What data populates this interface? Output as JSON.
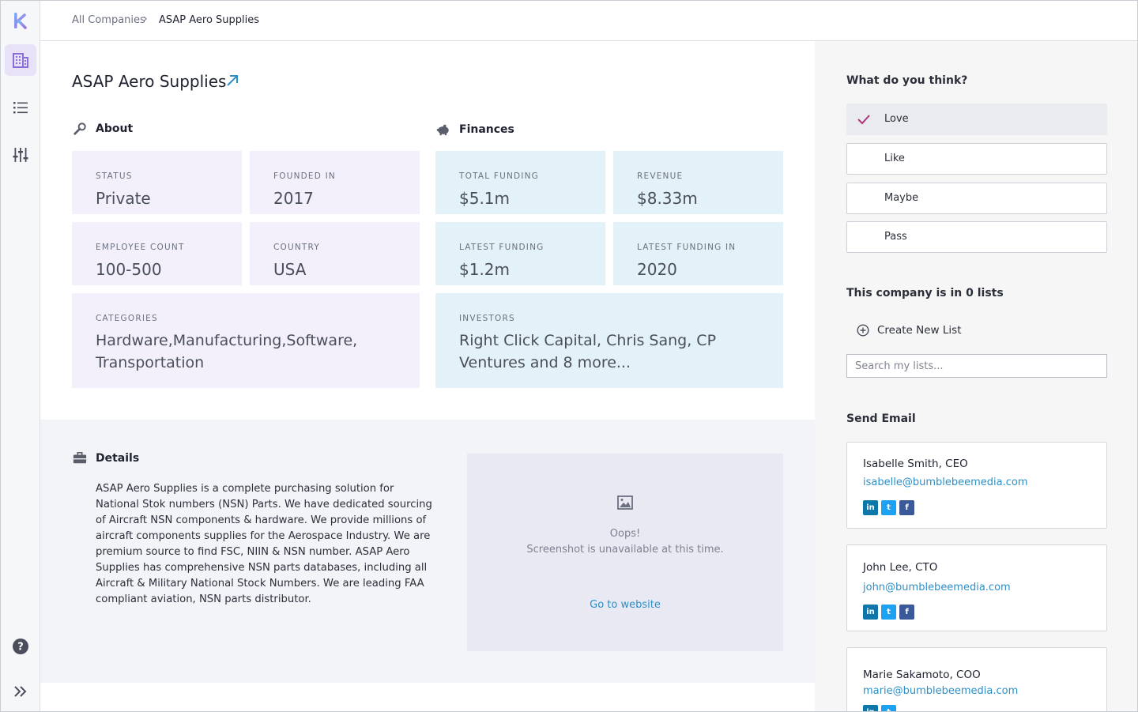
{
  "breadcrumb": {
    "root": "All Companies",
    "separator": "›",
    "current": "ASAP Aero Supplies"
  },
  "company": {
    "name": "ASAP Aero Supplies"
  },
  "about": {
    "heading": "About",
    "status_label": "STATUS",
    "status": "Private",
    "founded_label": "FOUNDED IN",
    "founded": "2017",
    "employees_label": "EMPLOYEE COUNT",
    "employees": "100-500",
    "country_label": "COUNTRY",
    "country": "USA",
    "categories_label": "CATEGORIES",
    "categories": "Hardware,Manufacturing,Software, Transportation"
  },
  "finances": {
    "heading": "Finances",
    "total_label": "TOTAL FUNDING",
    "total": "$5.1m",
    "revenue_label": "REVENUE",
    "revenue": "$8.33m",
    "latest_label": "LATEST FUNDING",
    "latest": "$1.2m",
    "latest_in_label": "LATEST FUNDING IN",
    "latest_in": "2020",
    "investors_label": "INVESTORS",
    "investors": "Right Click Capital, Chris Sang, CP Ventures and 8 more..."
  },
  "details": {
    "heading": "Details",
    "description": "ASAP Aero Supplies is a complete purchasing solution for National Stok numbers (NSN) Parts. We have dedicated sourcing of Aircraft NSN components & hardware. We provide millions of aircraft components supplies for the Aerospace Industry. We are premium source to find FSC, NIIN & NSN number. ASAP Aero Supplies has comprehensive NSN parts databases, including all Aircraft & Military National Stock Numbers. We are leading FAA compliant aviation, NSN parts distributor.",
    "screenshot_msg1": "Oops!",
    "screenshot_msg2": "Screenshot is unavailable at this time.",
    "go_website": "Go to website"
  },
  "opinion": {
    "heading": "What do you think?",
    "options": [
      "Love",
      "Like",
      "Maybe",
      "Pass"
    ],
    "selected": "Love",
    "check_color": "#b0357a"
  },
  "lists": {
    "heading": "This company is in 0 lists",
    "create": "Create New List",
    "search_placeholder": "Search my lists..."
  },
  "email": {
    "heading": "Send Email",
    "contacts": [
      {
        "name": "Isabelle Smith, CEO",
        "email": "isabelle@bumblebeemedia.com"
      },
      {
        "name": "John Lee, CTO",
        "email": "john@bumblebeemedia.com"
      },
      {
        "name": "Marie Sakamoto, COO",
        "email": "marie@bumblebeemedia.com"
      }
    ]
  },
  "icons": {
    "logo": "k-logo-icon",
    "companies": "building-icon",
    "lists": "list-icon",
    "filters": "sliders-icon",
    "help": "help-icon",
    "expand": "double-chevron-right-icon"
  },
  "colors": {
    "accent": "#8b6fd8",
    "about_bg": "#f3f0fc",
    "finance_bg": "#e3f2f8",
    "link": "#2d8fc7"
  }
}
